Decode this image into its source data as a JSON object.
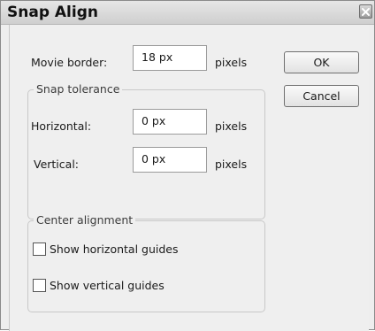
{
  "window": {
    "title": "Snap Align",
    "close_icon": "close-x-icon"
  },
  "movie_border": {
    "label": "Movie border:",
    "value": "18 px",
    "unit": "pixels"
  },
  "snap_tolerance": {
    "legend": "Snap tolerance",
    "horizontal": {
      "label": "Horizontal:",
      "value": "0 px",
      "unit": "pixels"
    },
    "vertical": {
      "label": "Vertical:",
      "value": "0 px",
      "unit": "pixels"
    }
  },
  "center_alignment": {
    "legend": "Center alignment",
    "show_horizontal": {
      "label": "Show horizontal guides",
      "checked": false
    },
    "show_vertical": {
      "label": "Show vertical guides",
      "checked": false
    }
  },
  "buttons": {
    "ok": "OK",
    "cancel": "Cancel"
  }
}
